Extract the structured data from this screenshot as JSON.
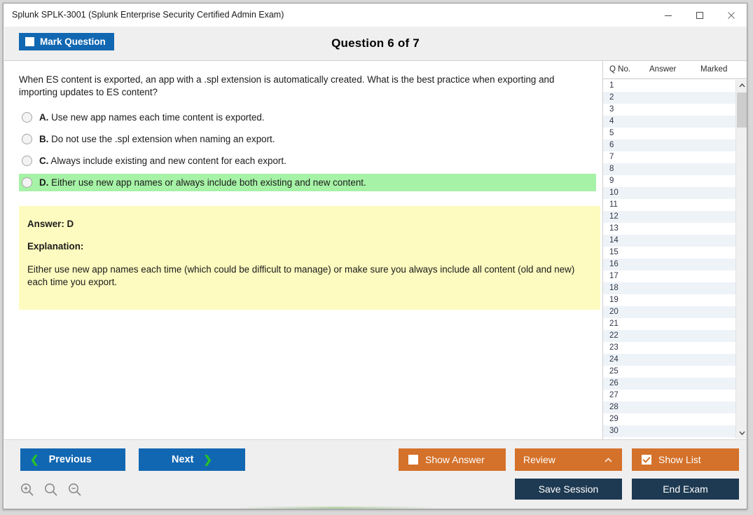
{
  "window": {
    "title": "Splunk SPLK-3001 (Splunk Enterprise Security Certified Admin Exam)",
    "minimize_label": "minimize-icon",
    "maximize_label": "maximize-icon",
    "close_label": "close-icon"
  },
  "header": {
    "mark_question_label": "Mark Question",
    "mark_question_checked": false,
    "question_title": "Question 6 of 7"
  },
  "question": {
    "text": "When ES content is exported, an app with a .spl extension is automatically created. What is the best practice when exporting and importing updates to ES content?",
    "selected": null,
    "correct": "D",
    "options": [
      {
        "letter": "A.",
        "text": "Use new app names each time content is exported.",
        "highlight": false
      },
      {
        "letter": "B.",
        "text": "Do not use the .spl extension when naming an export.",
        "highlight": false
      },
      {
        "letter": "C.",
        "text": "Always include existing and new content for each export.",
        "highlight": false
      },
      {
        "letter": "D.",
        "text": "Either use new app names or always include both existing and new content.",
        "highlight": true
      }
    ]
  },
  "answer_box": {
    "answer_label": "Answer: D",
    "explanation_label": "Explanation:",
    "explanation_text": "Either use new app names each time (which could be difficult to manage) or make sure you always include all content (old and new) each time you export."
  },
  "list_panel": {
    "columns": [
      "Q No.",
      "Answer",
      "Marked"
    ],
    "rows": [
      {
        "q": "1",
        "answer": "",
        "marked": ""
      },
      {
        "q": "2",
        "answer": "",
        "marked": ""
      },
      {
        "q": "3",
        "answer": "",
        "marked": ""
      },
      {
        "q": "4",
        "answer": "",
        "marked": ""
      },
      {
        "q": "5",
        "answer": "",
        "marked": ""
      },
      {
        "q": "6",
        "answer": "",
        "marked": ""
      },
      {
        "q": "7",
        "answer": "",
        "marked": ""
      },
      {
        "q": "8",
        "answer": "",
        "marked": ""
      },
      {
        "q": "9",
        "answer": "",
        "marked": ""
      },
      {
        "q": "10",
        "answer": "",
        "marked": ""
      },
      {
        "q": "11",
        "answer": "",
        "marked": ""
      },
      {
        "q": "12",
        "answer": "",
        "marked": ""
      },
      {
        "q": "13",
        "answer": "",
        "marked": ""
      },
      {
        "q": "14",
        "answer": "",
        "marked": ""
      },
      {
        "q": "15",
        "answer": "",
        "marked": ""
      },
      {
        "q": "16",
        "answer": "",
        "marked": ""
      },
      {
        "q": "17",
        "answer": "",
        "marked": ""
      },
      {
        "q": "18",
        "answer": "",
        "marked": ""
      },
      {
        "q": "19",
        "answer": "",
        "marked": ""
      },
      {
        "q": "20",
        "answer": "",
        "marked": ""
      },
      {
        "q": "21",
        "answer": "",
        "marked": ""
      },
      {
        "q": "22",
        "answer": "",
        "marked": ""
      },
      {
        "q": "23",
        "answer": "",
        "marked": ""
      },
      {
        "q": "24",
        "answer": "",
        "marked": ""
      },
      {
        "q": "25",
        "answer": "",
        "marked": ""
      },
      {
        "q": "26",
        "answer": "",
        "marked": ""
      },
      {
        "q": "27",
        "answer": "",
        "marked": ""
      },
      {
        "q": "28",
        "answer": "",
        "marked": ""
      },
      {
        "q": "29",
        "answer": "",
        "marked": ""
      },
      {
        "q": "30",
        "answer": "",
        "marked": ""
      }
    ],
    "scroll_up_icon": "chevron-up-icon",
    "scroll_down_icon": "chevron-down-icon"
  },
  "footer": {
    "previous_label": "Previous",
    "next_label": "Next",
    "show_answer_label": "Show Answer",
    "show_answer_checked": false,
    "review_label": "Review",
    "review_caret": "chevron-up-icon",
    "show_list_label": "Show List",
    "show_list_checked": true,
    "save_session_label": "Save Session",
    "end_exam_label": "End Exam",
    "zoom_in_icon": "zoom-in-icon",
    "zoom_reset_icon": "search-icon",
    "zoom_out_icon": "zoom-out-icon"
  },
  "colors": {
    "blue": "#1267b2",
    "orange": "#d4712a",
    "navy": "#1e3a52",
    "green_highlight": "#a6f2a6",
    "yellow_box": "#fdfbbf",
    "chevron_green": "#27c12a"
  }
}
